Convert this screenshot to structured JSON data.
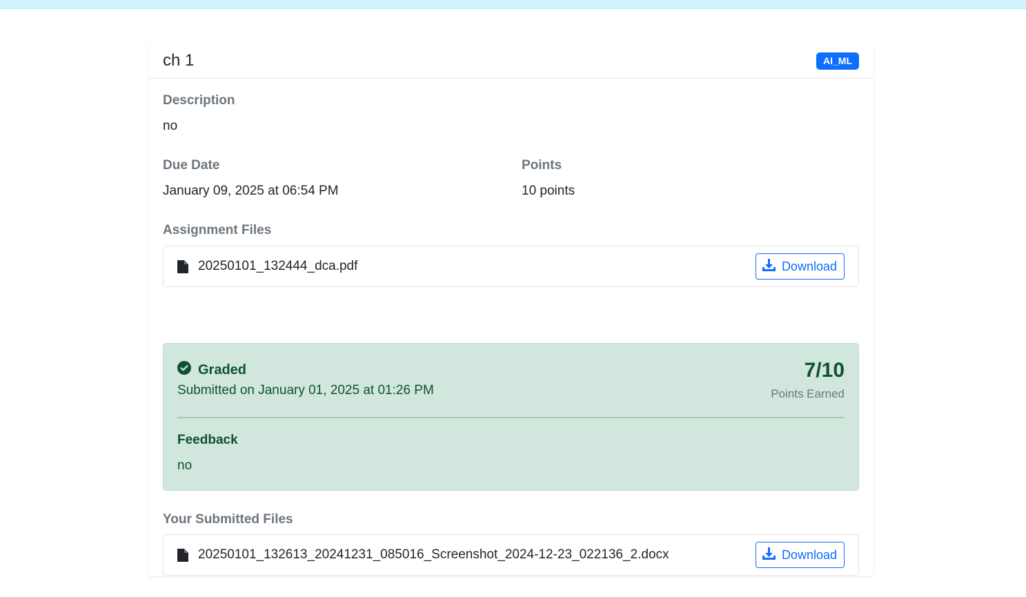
{
  "assignment": {
    "title": "ch 1",
    "course_badge": "AI_ML",
    "description_label": "Description",
    "description": "no",
    "due_date_label": "Due Date",
    "due_date": "January 09, 2025 at 06:54 PM",
    "points_label": "Points",
    "points": "10 points"
  },
  "assignment_files": {
    "label": "Assignment Files",
    "files": [
      {
        "name": "20250101_132444_dca.pdf",
        "icon": "file-icon",
        "download_label": "Download"
      }
    ]
  },
  "grading": {
    "status": "Graded",
    "status_icon": "check-circle-icon",
    "submitted_text": "Submitted on January 01, 2025 at 01:26 PM",
    "score": "7/10",
    "score_label": "Points Earned",
    "feedback_label": "Feedback",
    "feedback": "no"
  },
  "submitted_files": {
    "label": "Your Submitted Files",
    "files": [
      {
        "name": "20250101_132613_20241231_085016_Screenshot_2024-12-23_022136_2.docx",
        "icon": "file-icon",
        "download_label": "Download"
      }
    ]
  },
  "colors": {
    "primary": "#0d6efd",
    "success_bg": "#d1e7dd",
    "success_text": "#0f5132",
    "top_banner": "#cff4fc"
  }
}
